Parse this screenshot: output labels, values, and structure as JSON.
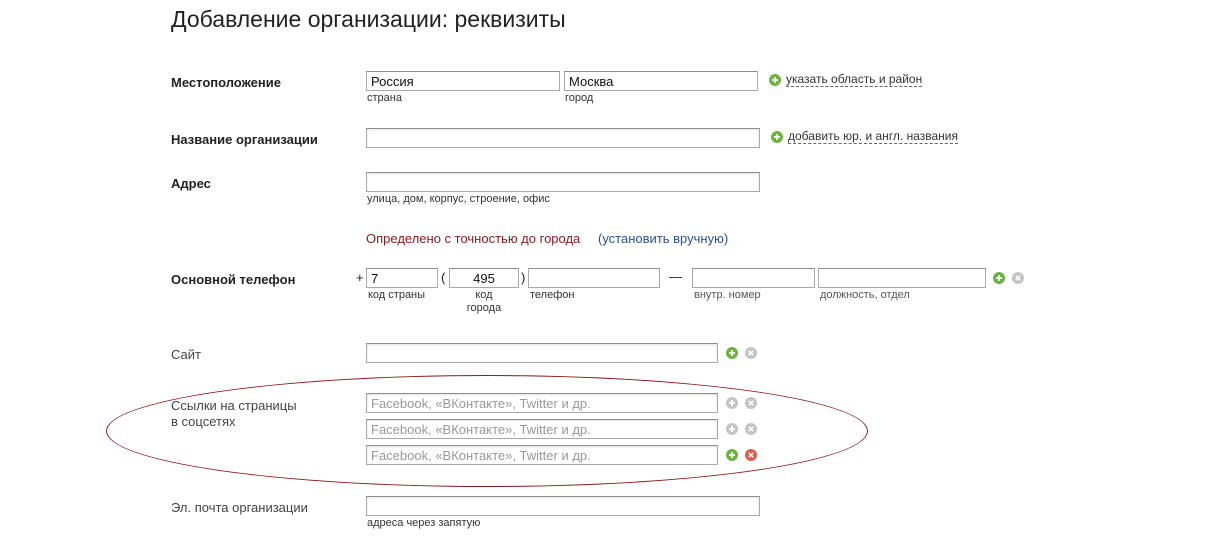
{
  "page_title": "Добавление организации: реквизиты",
  "location": {
    "label": "Местоположение",
    "country_value": "Россия",
    "country_hint": "страна",
    "city_value": "Москва",
    "city_hint": "город",
    "add_link": "указать область и район"
  },
  "org_name": {
    "label": "Название организации",
    "value": "",
    "add_link": "добавить юр. и англ. названия"
  },
  "address": {
    "label": "Адрес",
    "value": "",
    "hint": "улица, дом, корпус, строение, офис",
    "accuracy_text": "Определено с точностью до города",
    "manual_link": "(установить вручную)"
  },
  "phone": {
    "label": "Основной телефон",
    "plus": "+",
    "open_paren": "(",
    "close_paren": ")",
    "dash": "—",
    "country_code_value": "7",
    "country_code_hint": "код страны",
    "city_code_value": "495",
    "city_code_hint_line1": "код",
    "city_code_hint_line2": "города",
    "number_value": "",
    "number_hint": "телефон",
    "ext_value": "",
    "ext_hint": "внутр. номер",
    "position_value": "",
    "position_hint": "должность, отдел"
  },
  "site": {
    "label": "Сайт",
    "value": ""
  },
  "social": {
    "label_line1": "Ссылки на страницы",
    "label_line2": "в соцсетях",
    "placeholder": "Facebook, «ВКонтакте», Twitter и др.",
    "rows": 3
  },
  "email": {
    "label": "Эл. почта организации",
    "value": "",
    "hint": "адреса через запятую"
  },
  "colors": {
    "add_active": "#6cb33f",
    "add_inactive": "#c4c4c4",
    "remove_inactive": "#c4c4c4",
    "remove_active": "#e05a4f",
    "annotation": "#8b1a1a",
    "link_blue": "#2a4f9b"
  }
}
